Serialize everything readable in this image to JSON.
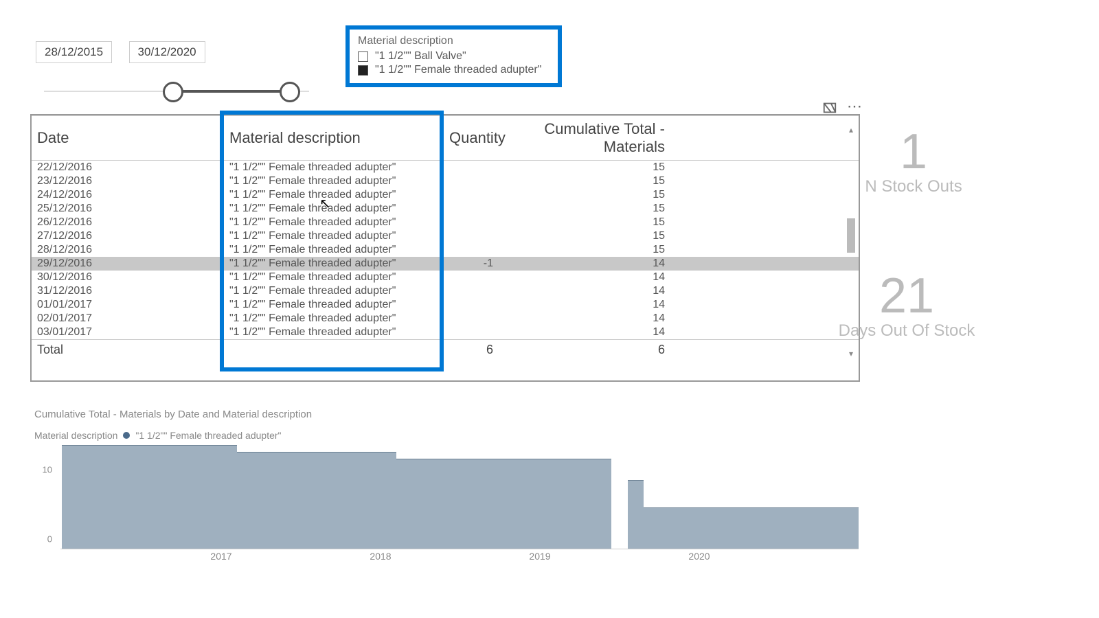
{
  "slicer_date": {
    "start": "28/12/2015",
    "end": "30/12/2020"
  },
  "slicer_material": {
    "title": "Material description",
    "items": [
      {
        "label": "\"1 1/2\"\" Ball Valve\"",
        "checked": false
      },
      {
        "label": "\"1 1/2\"\" Female threaded adupter\"",
        "checked": true
      }
    ]
  },
  "table": {
    "columns": [
      "Date",
      "Material description",
      "Quantity",
      "Cumulative Total - Materials"
    ],
    "rows": [
      {
        "date": "22/12/2016",
        "mat": "\"1 1/2\"\" Female threaded adupter\"",
        "qty": "",
        "cum": "15"
      },
      {
        "date": "23/12/2016",
        "mat": "\"1 1/2\"\" Female threaded adupter\"",
        "qty": "",
        "cum": "15"
      },
      {
        "date": "24/12/2016",
        "mat": "\"1 1/2\"\" Female threaded adupter\"",
        "qty": "",
        "cum": "15"
      },
      {
        "date": "25/12/2016",
        "mat": "\"1 1/2\"\" Female threaded adupter\"",
        "qty": "",
        "cum": "15"
      },
      {
        "date": "26/12/2016",
        "mat": "\"1 1/2\"\" Female threaded adupter\"",
        "qty": "",
        "cum": "15"
      },
      {
        "date": "27/12/2016",
        "mat": "\"1 1/2\"\" Female threaded adupter\"",
        "qty": "",
        "cum": "15"
      },
      {
        "date": "28/12/2016",
        "mat": "\"1 1/2\"\" Female threaded adupter\"",
        "qty": "",
        "cum": "15"
      },
      {
        "date": "29/12/2016",
        "mat": "\"1 1/2\"\" Female threaded adupter\"",
        "qty": "-1",
        "cum": "14",
        "selected": true
      },
      {
        "date": "30/12/2016",
        "mat": "\"1 1/2\"\" Female threaded adupter\"",
        "qty": "",
        "cum": "14"
      },
      {
        "date": "31/12/2016",
        "mat": "\"1 1/2\"\" Female threaded adupter\"",
        "qty": "",
        "cum": "14"
      },
      {
        "date": "01/01/2017",
        "mat": "\"1 1/2\"\" Female threaded adupter\"",
        "qty": "",
        "cum": "14"
      },
      {
        "date": "02/01/2017",
        "mat": "\"1 1/2\"\" Female threaded adupter\"",
        "qty": "",
        "cum": "14"
      },
      {
        "date": "03/01/2017",
        "mat": "\"1 1/2\"\" Female threaded adupter\"",
        "qty": "",
        "cum": "14"
      }
    ],
    "total_label": "Total",
    "total_qty": "6",
    "total_cum": "6"
  },
  "cards": {
    "stockouts": {
      "value": "1",
      "label": "N Stock Outs"
    },
    "days": {
      "value": "21",
      "label": "Days Out Of Stock"
    }
  },
  "chart": {
    "title": "Cumulative Total - Materials by Date and Material description",
    "legend_label": "Material description",
    "legend_series": "\"1 1/2\"\" Female threaded adupter\""
  },
  "chart_data": {
    "type": "area",
    "title": "Cumulative Total - Materials by Date and Material description",
    "xlabel": "",
    "ylabel": "",
    "ylim": [
      0,
      15
    ],
    "yticks": [
      0,
      10
    ],
    "x_categories": [
      "2017",
      "2018",
      "2019",
      "2020"
    ],
    "series": [
      {
        "name": "\"1 1/2\"\" Female threaded adupter\"",
        "segments": [
          {
            "x0": 2016.0,
            "x1": 2017.1,
            "value": 15
          },
          {
            "x0": 2017.1,
            "x1": 2018.1,
            "value": 14
          },
          {
            "x0": 2018.1,
            "x1": 2019.45,
            "value": 13
          },
          {
            "x0": 2019.45,
            "x1": 2019.55,
            "value": 0
          },
          {
            "x0": 2019.55,
            "x1": 2019.65,
            "value": 10
          },
          {
            "x0": 2019.65,
            "x1": 2021.0,
            "value": 6
          }
        ]
      }
    ]
  }
}
